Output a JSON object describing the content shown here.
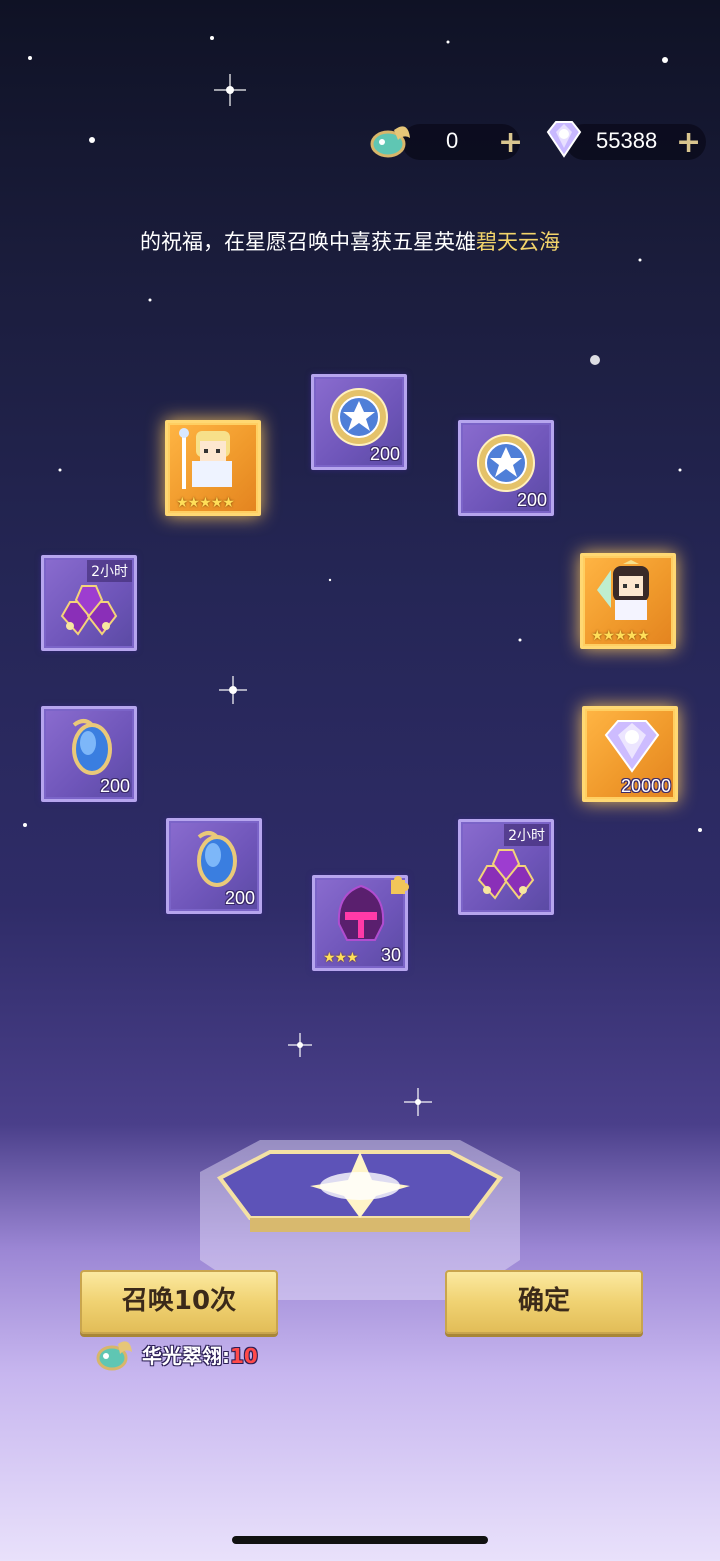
{
  "currency": {
    "feather_value": "0",
    "diamond_value": "55388",
    "feather_icon": "feather-currency-icon",
    "diamond_icon": "diamond-currency-icon"
  },
  "marquee": {
    "text_plain": "的祝福，在星愿召唤中喜获五星英雄",
    "text_highlight": "碧天云海"
  },
  "rewards": [
    {
      "name": "hero-blonde-knight",
      "type": "hero",
      "rarity": "gold",
      "stars": "★★★★★"
    },
    {
      "name": "star-medal",
      "type": "item",
      "count": "200"
    },
    {
      "name": "star-medal",
      "type": "item",
      "count": "200"
    },
    {
      "name": "exp-potion",
      "type": "item",
      "tag": "2小时"
    },
    {
      "name": "hero-dark-hair-mage",
      "type": "hero",
      "rarity": "gold",
      "stars": "★★★★★"
    },
    {
      "name": "blue-crystal",
      "type": "item",
      "count": "200"
    },
    {
      "name": "diamond",
      "type": "item",
      "rarity": "gold",
      "count": "20000"
    },
    {
      "name": "blue-crystal",
      "type": "item",
      "count": "200"
    },
    {
      "name": "exp-potion",
      "type": "item",
      "tag": "2小时"
    },
    {
      "name": "helmet-shard",
      "type": "item",
      "count": "30",
      "stars": "★★★"
    }
  ],
  "buttons": {
    "summon_label": "召唤10次",
    "confirm_label": "确定"
  },
  "cost": {
    "label": "华光翠翎:",
    "amount": "10"
  },
  "colors": {
    "highlight": "#f3d46b",
    "cost_red": "#ff4a4a",
    "slot_purple": "#6e55b9",
    "slot_gold": "#f09a2c"
  }
}
